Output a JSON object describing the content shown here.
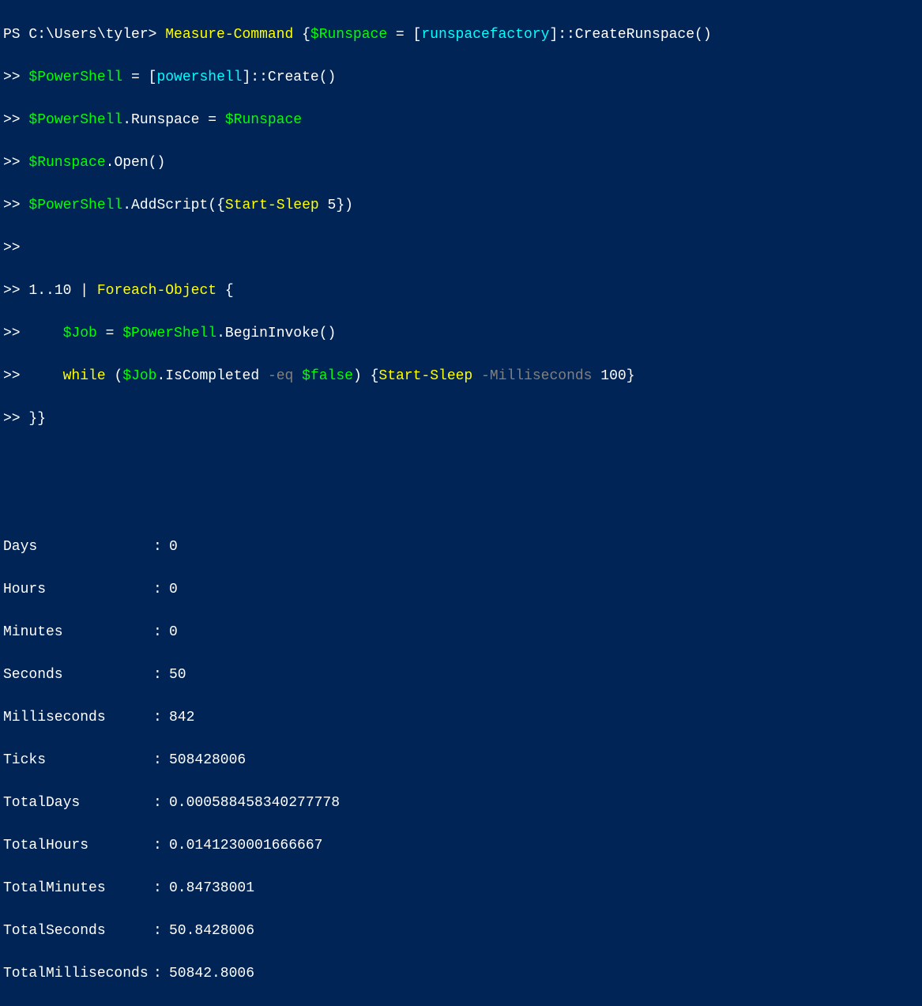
{
  "prompt": {
    "ps": "PS ",
    "path": "C:\\Users\\tyler",
    "suffix": "> "
  },
  "continuation": ">> ",
  "code": {
    "line1": {
      "cmd": "Measure-Command",
      "space": " ",
      "brace": "{",
      "var1": "$Runspace",
      "assign": " = ",
      "bracket1": "[",
      "type1": "runspacefactory",
      "bracket2": "]",
      "coloncolon": "::",
      "method": "CreateRunspace()"
    },
    "line2": {
      "var": "$PowerShell",
      "assign": " = ",
      "bracket1": "[",
      "type": "powershell",
      "bracket2": "]",
      "coloncolon": "::",
      "method": "Create()"
    },
    "line3": {
      "var1": "$PowerShell",
      "dot": ".",
      "prop": "Runspace",
      "assign": " = ",
      "var2": "$Runspace"
    },
    "line4": {
      "var": "$Runspace",
      "dot": ".",
      "method": "Open()"
    },
    "line5": {
      "var": "$PowerShell",
      "dot": ".",
      "method": "AddScript(",
      "brace1": "{",
      "cmd": "Start-Sleep",
      "space": " ",
      "num": "5",
      "brace2": "}",
      "close": ")"
    },
    "line7": {
      "num1": "1",
      "range": "..",
      "num2": "10",
      "pipe": " | ",
      "cmd": "Foreach-Object",
      "space": " ",
      "brace": "{"
    },
    "line8": {
      "indent": "    ",
      "var1": "$Job",
      "assign": " = ",
      "var2": "$PowerShell",
      "dot": ".",
      "method": "BeginInvoke()"
    },
    "line9": {
      "indent": "    ",
      "keyword": "while",
      "space": " ",
      "paren1": "(",
      "var": "$Job",
      "dot": ".",
      "prop": "IsCompleted",
      "space2": " ",
      "op": "-eq",
      "space3": " ",
      "val": "$false",
      "paren2": ")",
      "space4": " ",
      "brace1": "{",
      "cmd": "Start-Sleep",
      "space5": " ",
      "param": "-Milliseconds",
      "space6": " ",
      "num": "100",
      "brace2": "}"
    },
    "line10": {
      "braces": "}}"
    }
  },
  "output": {
    "rows": [
      {
        "label": "Days",
        "value": "0"
      },
      {
        "label": "Hours",
        "value": "0"
      },
      {
        "label": "Minutes",
        "value": "0"
      },
      {
        "label": "Seconds",
        "value": "50"
      },
      {
        "label": "Milliseconds",
        "value": "842"
      },
      {
        "label": "Ticks",
        "value": "508428006"
      },
      {
        "label": "TotalDays",
        "value": "0.000588458340277778"
      },
      {
        "label": "TotalHours",
        "value": "0.0141230001666667"
      },
      {
        "label": "TotalMinutes",
        "value": "0.84738001"
      },
      {
        "label": "TotalSeconds",
        "value": "50.8428006"
      },
      {
        "label": "TotalMilliseconds",
        "value": "50842.8006"
      }
    ],
    "separator": ":"
  }
}
